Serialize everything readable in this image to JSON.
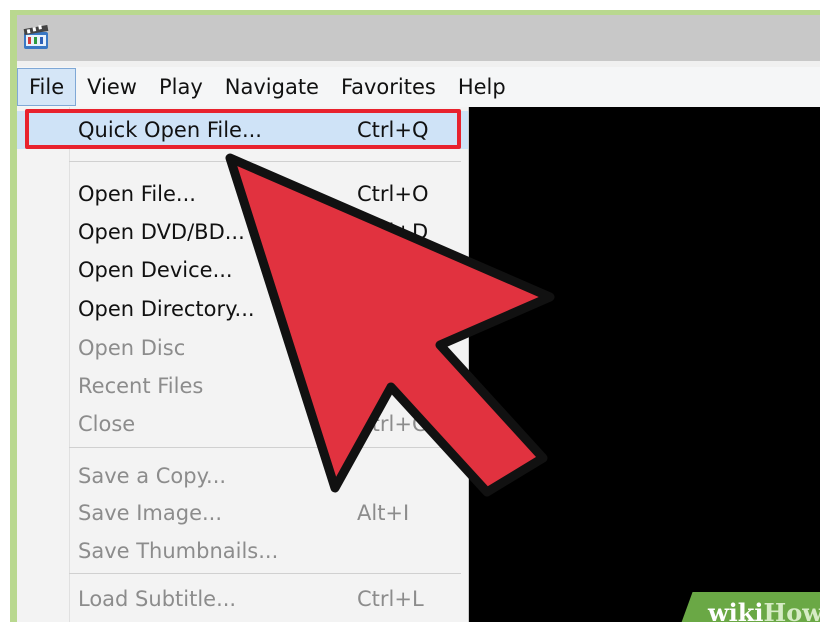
{
  "menubar": {
    "items": [
      {
        "label": "File"
      },
      {
        "label": "View"
      },
      {
        "label": "Play"
      },
      {
        "label": "Navigate"
      },
      {
        "label": "Favorites"
      },
      {
        "label": "Help"
      }
    ]
  },
  "file_menu": {
    "items": [
      {
        "label": "Quick Open File...",
        "shortcut": "Ctrl+Q",
        "enabled": true,
        "highlighted": true
      },
      {
        "label": "Open File...",
        "shortcut": "Ctrl+O",
        "enabled": true
      },
      {
        "label": "Open DVD/BD...",
        "shortcut": "Ctrl+D",
        "enabled": true
      },
      {
        "label": "Open Device...",
        "shortcut": "",
        "enabled": true
      },
      {
        "label": "Open Directory...",
        "shortcut": "",
        "enabled": true
      },
      {
        "label": "Open Disc",
        "shortcut": "",
        "enabled": false
      },
      {
        "label": "Recent Files",
        "shortcut": "",
        "enabled": false
      },
      {
        "label": "Close",
        "shortcut": "Ctrl+C",
        "enabled": false
      },
      {
        "label": "Save a Copy...",
        "shortcut": "",
        "enabled": false
      },
      {
        "label": "Save Image...",
        "shortcut": "Alt+I",
        "enabled": false
      },
      {
        "label": "Save Thumbnails...",
        "shortcut": "",
        "enabled": false
      },
      {
        "label": "Load Subtitle...",
        "shortcut": "Ctrl+L",
        "enabled": false
      }
    ]
  },
  "watermark": {
    "part1": "wiki",
    "part2": "How"
  },
  "colors": {
    "highlight_border": "#e8222e",
    "arrow_fill": "#e1323f",
    "menu_hover": "#cfe3f7",
    "background_frame": "#b9d88f"
  }
}
